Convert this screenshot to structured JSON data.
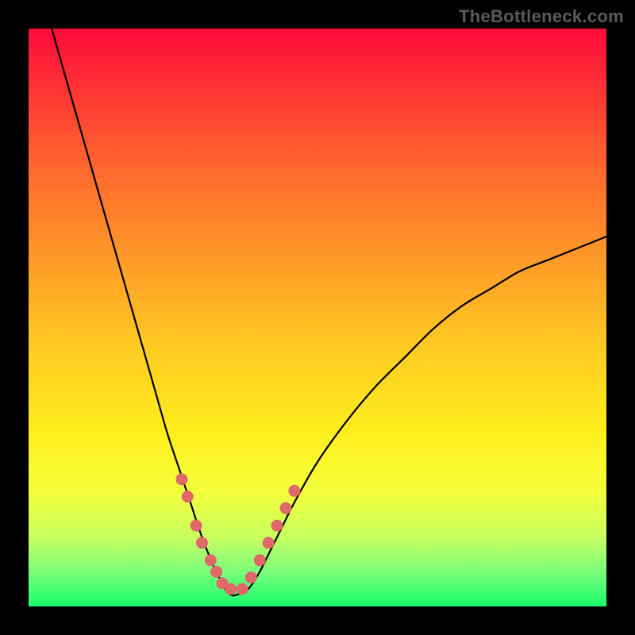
{
  "watermark": "TheBottleneck.com",
  "colors": {
    "frame": "#000000",
    "curve": "#000000",
    "marker_fill": "#e06868",
    "marker_stroke": "#cc5555"
  },
  "chart_data": {
    "type": "line",
    "title": "",
    "xlabel": "",
    "ylabel": "",
    "xlim": [
      0,
      100
    ],
    "ylim": [
      0,
      100
    ],
    "grid": false,
    "legend": false,
    "series": [
      {
        "name": "bottleneck-curve",
        "x": [
          4,
          6,
          8,
          10,
          12,
          14,
          16,
          18,
          20,
          22,
          24,
          26,
          28,
          30,
          32,
          33,
          34,
          35,
          36,
          38,
          40,
          42,
          44,
          46,
          50,
          55,
          60,
          65,
          70,
          75,
          80,
          85,
          90,
          95,
          100
        ],
        "y": [
          100,
          93,
          86,
          79,
          72,
          65,
          58,
          51,
          44,
          37,
          30,
          24,
          18,
          12,
          7,
          5,
          3,
          2,
          2,
          3,
          6,
          10,
          14,
          18,
          25,
          32,
          38,
          43,
          48,
          52,
          55,
          58,
          60,
          62,
          64
        ]
      }
    ],
    "markers": {
      "name": "highlighted-points",
      "x": [
        26.5,
        27.5,
        29.0,
        30.0,
        31.5,
        32.5,
        33.5,
        35.0,
        37.0,
        38.5,
        40.0,
        41.5,
        43.0,
        44.5,
        46.0
      ],
      "y": [
        22,
        19,
        14,
        11,
        8,
        6,
        4,
        3,
        3,
        5,
        8,
        11,
        14,
        17,
        20
      ]
    }
  }
}
